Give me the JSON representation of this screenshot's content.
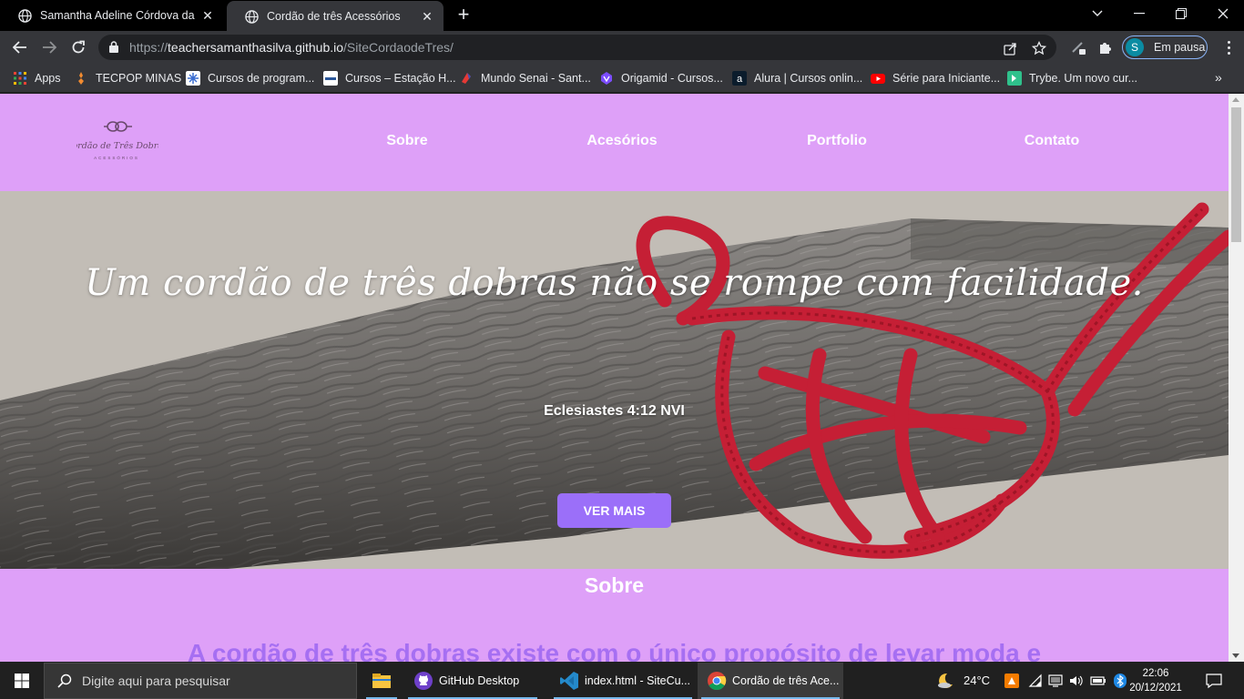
{
  "tabs": [
    {
      "title": "Samantha Adeline Córdova da Si",
      "active": false
    },
    {
      "title": "Cordão de três Acessórios",
      "active": true
    }
  ],
  "address_bar": {
    "scheme": "https://",
    "host": "teachersamanthasilva.github.io",
    "path": "/SiteCordaodeTres/"
  },
  "profile": {
    "initial": "S",
    "status": "Em pausa"
  },
  "bookmarks": [
    {
      "label": "Apps",
      "icon": "apps-grid-icon",
      "color": "#e8453c"
    },
    {
      "label": "TECPOP MINAS",
      "icon": "tecpop-icon",
      "color": "#f28b30"
    },
    {
      "label": "Cursos de program...",
      "icon": "snowflake-icon",
      "color": "#4285f4"
    },
    {
      "label": "Cursos – Estação H...",
      "icon": "estacao-icon",
      "color": "#ffffff"
    },
    {
      "label": "Mundo Senai - Sant...",
      "icon": "senai-icon",
      "color": "#e53935"
    },
    {
      "label": "Origamid - Cursos...",
      "icon": "origamid-icon",
      "color": "#7c4dff"
    },
    {
      "label": "Alura | Cursos onlin...",
      "icon": "alura-icon",
      "color": "#0b1c2c"
    },
    {
      "label": "Série para Iniciante...",
      "icon": "youtube-icon",
      "color": "#ff0000"
    },
    {
      "label": "Trybe. Um novo cur...",
      "icon": "trybe-icon",
      "color": "#2fc18c"
    }
  ],
  "site": {
    "colors": {
      "header_bg": "#dea0f8",
      "button_bg": "#9b6ff9",
      "accent_text": "#a66ff2"
    },
    "logo_text": "Cordão de Três Dobras",
    "nav": [
      "Sobre",
      "Acesórios",
      "Portfolio",
      "Contato"
    ],
    "hero": {
      "quote": "Um cordão de três dobras não se rompe com facilidade.",
      "reference": "Eclesiastes 4:12 NVI",
      "button": "VER MAIS"
    },
    "sobre": {
      "title": "Sobre",
      "text": "A cordão de três dobras existe com o único propósito de levar moda e"
    }
  },
  "taskbar": {
    "search_placeholder": "Digite aqui para pesquisar",
    "apps": [
      {
        "label": "",
        "icon": "file-explorer-icon"
      },
      {
        "label": "GitHub Desktop",
        "icon": "github-icon"
      },
      {
        "label": "index.html - SiteCu...",
        "icon": "vscode-icon"
      },
      {
        "label": "Cordão de três Ace...",
        "icon": "chrome-icon"
      }
    ],
    "weather": "24°C",
    "time": "22:06",
    "date": "20/12/2021"
  }
}
